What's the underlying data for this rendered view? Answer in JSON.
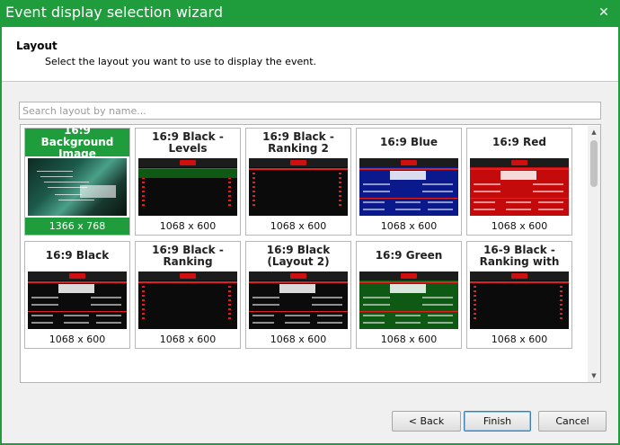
{
  "window": {
    "title": "Event display selection wizard",
    "close_glyph": "✕"
  },
  "header": {
    "title": "Layout",
    "subtitle": "Select the layout you want to use to display the event."
  },
  "search": {
    "placeholder": "Search layout by name..."
  },
  "layouts": [
    {
      "name": "16:9 Background Image",
      "size": "1366 x 768",
      "selected": true,
      "theme": "background-image"
    },
    {
      "name": "16:9 Black - Levels",
      "size": "1068 x 600",
      "selected": false,
      "theme": "black-levels"
    },
    {
      "name": "16:9 Black - Ranking 2",
      "size": "1068 x 600",
      "selected": false,
      "theme": "black-ranking"
    },
    {
      "name": "16:9 Blue",
      "size": "1068 x 600",
      "selected": false,
      "theme": "blue"
    },
    {
      "name": "16:9 Red",
      "size": "1068 x 600",
      "selected": false,
      "theme": "red"
    },
    {
      "name": "16:9 Black",
      "size": "1068 x 600",
      "selected": false,
      "theme": "black"
    },
    {
      "name": "16:9 Black - Ranking",
      "size": "1068 x 600",
      "selected": false,
      "theme": "black-ranking"
    },
    {
      "name": "16:9 Black (Layout 2)",
      "size": "1068 x 600",
      "selected": false,
      "theme": "black-layout2"
    },
    {
      "name": "16:9 Green",
      "size": "1068 x 600",
      "selected": false,
      "theme": "green"
    },
    {
      "name": "16-9 Black - Ranking with",
      "size": "1068 x 600",
      "selected": false,
      "theme": "black-ranking"
    }
  ],
  "buttons": {
    "back": "< Back",
    "finish": "Finish",
    "cancel": "Cancel"
  },
  "colors": {
    "accent_green": "#1f9d3c",
    "blue_theme": "#0a1a8c",
    "red_theme": "#c40a0a",
    "green_theme": "#0e5a14",
    "black_theme": "#0b0b0b"
  }
}
